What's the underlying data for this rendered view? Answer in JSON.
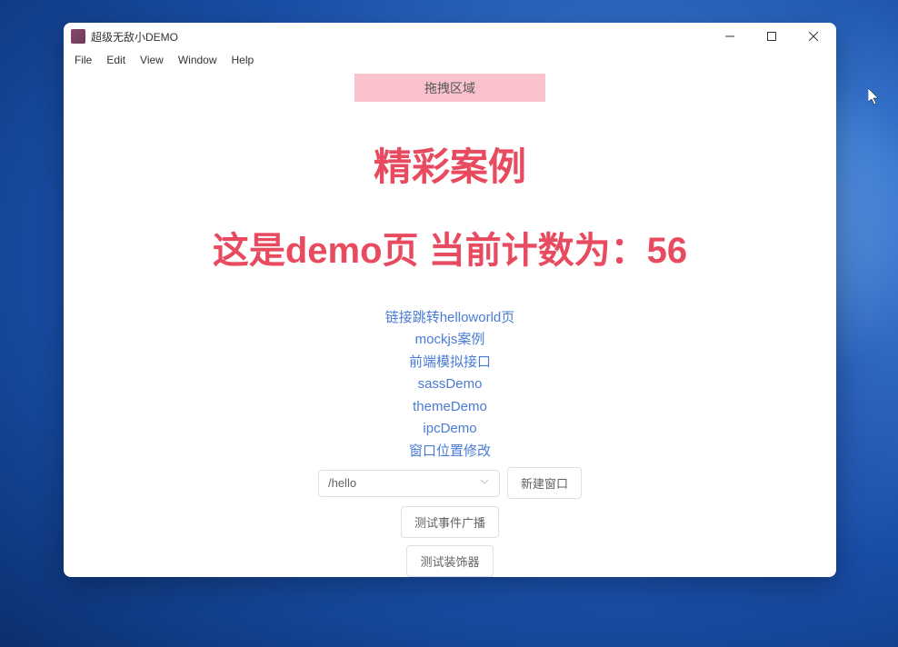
{
  "window": {
    "title": "超级无敌小DEMO"
  },
  "menubar": {
    "items": [
      "File",
      "Edit",
      "View",
      "Window",
      "Help"
    ]
  },
  "dragZone": {
    "label": "拖拽区域"
  },
  "headings": {
    "main": "精彩案例",
    "sub": "这是demo页 当前计数为：56"
  },
  "links": [
    "链接跳转helloworld页",
    "mockjs案例",
    "前端模拟接口",
    "sassDemo",
    "themeDemo",
    "ipcDemo",
    "窗口位置修改"
  ],
  "select": {
    "value": "/hello"
  },
  "buttons": {
    "newWindow": "新建窗口",
    "testBroadcast": "测试事件广播",
    "testDecorator": "测试装饰器"
  }
}
